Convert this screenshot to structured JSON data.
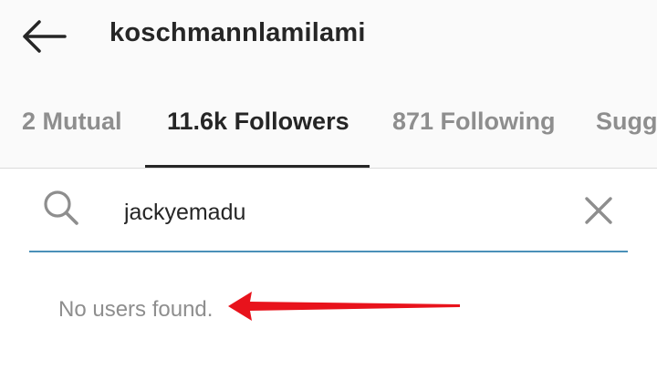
{
  "header": {
    "username": "koschmannlamilami",
    "back_icon": "arrow-left-icon"
  },
  "tabs": [
    {
      "label": "2 Mutual",
      "active": false
    },
    {
      "label": "11.6k Followers",
      "active": true
    },
    {
      "label": "871 Following",
      "active": false
    },
    {
      "label": "Sugg",
      "active": false
    }
  ],
  "search": {
    "value": "jackyemadu",
    "search_icon": "search-icon",
    "clear_icon": "close-icon"
  },
  "results": {
    "empty_message": "No users found."
  },
  "colors": {
    "accent_underline": "#4a90b8",
    "annotation_arrow": "#e8131c"
  }
}
